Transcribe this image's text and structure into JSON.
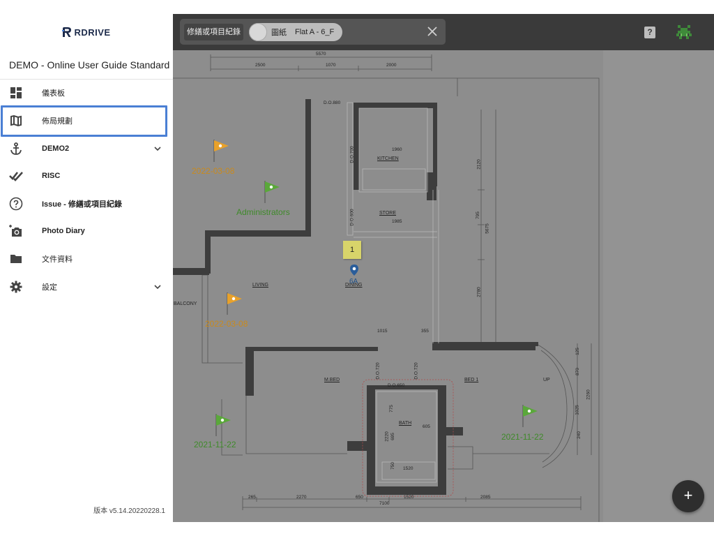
{
  "app": {
    "logo_text": "RDRIVE",
    "project_title": "DEMO - Online User Guide Standard",
    "version": "版本 v5.14.20220228.1"
  },
  "sidebar": {
    "items": [
      {
        "label": "儀表板",
        "icon": "dashboard-icon"
      },
      {
        "label": "佈局規劃",
        "icon": "map-icon",
        "selected": true
      },
      {
        "label": "DEMO2",
        "icon": "anchor-icon",
        "expandable": true
      },
      {
        "label": "RISC",
        "icon": "double-check-icon"
      },
      {
        "label": "Issue - 修繕或項目紀錄",
        "icon": "help-circle-icon"
      },
      {
        "label": "Photo Diary",
        "icon": "add-camera-icon"
      },
      {
        "label": "文件資料",
        "icon": "folder-icon"
      },
      {
        "label": "設定",
        "icon": "gear-icon",
        "expandable": true
      }
    ]
  },
  "topbar": {
    "scope_chip": "修繕或項目紀錄",
    "drawing_type": "圖紙",
    "drawing_name": "Flat A - 6_F"
  },
  "plan": {
    "flags": [
      {
        "label": "2022-03-08",
        "color": "#e8a12a"
      },
      {
        "label": "Administrators",
        "color": "#5aa83a"
      },
      {
        "label": "2022-03-08",
        "color": "#e8a12a"
      },
      {
        "label": "2021-11-22",
        "color": "#5aa83a"
      },
      {
        "label": "2021-11-22",
        "color": "#5aa83a"
      }
    ],
    "sticky_note": "1",
    "pin_label": "6A",
    "rooms": [
      "KITCHEN",
      "STORE",
      "LIVING",
      "DINING",
      "BALCONY",
      "M.BED",
      "BED 1",
      "BATH",
      "UP"
    ],
    "dimensions": {
      "top_total": "5570",
      "top": [
        "2500",
        "1070",
        "2000"
      ],
      "bottom_total": "7100",
      "bottom": [
        "265",
        "2270",
        "650",
        "1520",
        "2085"
      ],
      "kitchen_width": "1960",
      "store_width": "1985",
      "bath_width": "1520",
      "right_column": [
        "2120",
        "795",
        "5675",
        "2780"
      ],
      "right_bay": [
        "125",
        "870",
        "2260",
        "1025",
        "240"
      ],
      "door_top": "D.O.880",
      "door_kitchen": "D.O.700",
      "door_store": "D.O.600",
      "door_mbed": "D.O.720",
      "door_bed1": "D.O.720",
      "door_bath": "D.O.650",
      "dining_1015": "1015",
      "dining_355": "355",
      "bath_775": "775",
      "bath_605": "605",
      "bath_2220": "2220",
      "bath_695": "695",
      "bath_750": "750"
    }
  },
  "fab": {
    "label": "+"
  },
  "colors": {
    "accent": "#4a7fd4",
    "flag_orange": "#e8a12a",
    "flag_green": "#5aa83a"
  }
}
